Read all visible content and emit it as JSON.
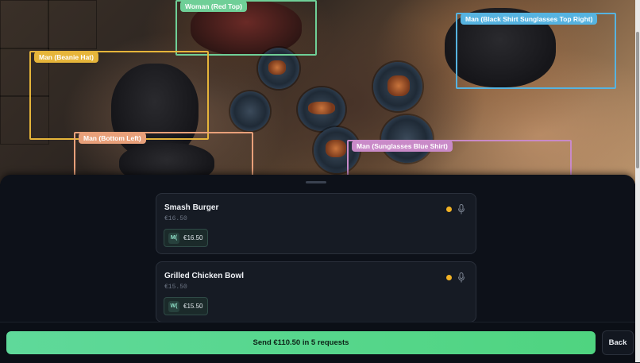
{
  "photo": {
    "detections": [
      {
        "label": "Woman (Red Top)",
        "color": "#6fcf97"
      },
      {
        "label": "Man (Black Shirt Sunglasses Top Right)",
        "color": "#56b3e0"
      },
      {
        "label": "Man (Beanie Hat)",
        "color": "#e6b53a"
      },
      {
        "label": "Man (Bottom Left)",
        "color": "#e8a07a"
      },
      {
        "label": "Man (Sunglasses Blue Shirt)",
        "color": "#c98ac8"
      }
    ]
  },
  "items": [
    {
      "name": "Smash Burger",
      "price": "€16.50",
      "assignee_initial": "M(",
      "assigned_amount": "€16.50",
      "status_color": "#f2b224"
    },
    {
      "name": "Grilled Chicken Bowl",
      "price": "€15.50",
      "assignee_initial": "W(",
      "assigned_amount": "€15.50",
      "status_color": "#f2b224"
    }
  ],
  "footer": {
    "send_label": "Send €110.50 in 5 requests",
    "back_label": "Back"
  },
  "colors": {
    "accent": "#5fd99a",
    "sheet_bg": "#0d1119",
    "card_bg": "#161b24"
  }
}
